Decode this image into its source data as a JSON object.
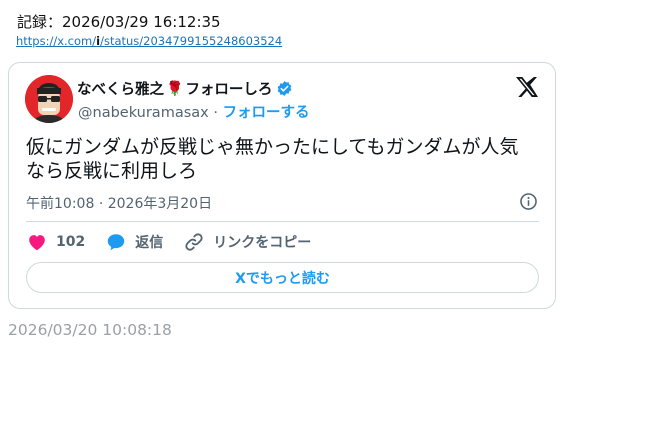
{
  "record": {
    "header": "記録：2026/03/29 16:12:35",
    "url_prefix": "https://x.com/",
    "url_bold": "i",
    "url_suffix": "/status/2034799155248603524"
  },
  "tweet": {
    "display_name": "なべくら雅之",
    "rose": "🌹",
    "name_suffix": "フォローしろ",
    "handle": "@nabekuramasax",
    "separator": "·",
    "follow_label": "フォローする",
    "text": "仮にガンダムが反戦じゃ無かったにしてもガンダムが人気なら反戦に利用しろ",
    "time": "午前10:08",
    "date": "2026年3月20日",
    "likes": "102",
    "reply_label": "返信",
    "copy_link_label": "リンクをコピー",
    "read_more_label": "Xでもっと読む"
  },
  "footer": {
    "timestamp": "2026/03/20 10:08:18"
  },
  "colors": {
    "accent": "#1d9bf0",
    "like": "#f91880",
    "muted": "#536471"
  },
  "icons": [
    "avatar",
    "verified-badge-icon",
    "x-logo-icon",
    "info-icon",
    "heart-icon",
    "reply-icon",
    "link-icon"
  ]
}
